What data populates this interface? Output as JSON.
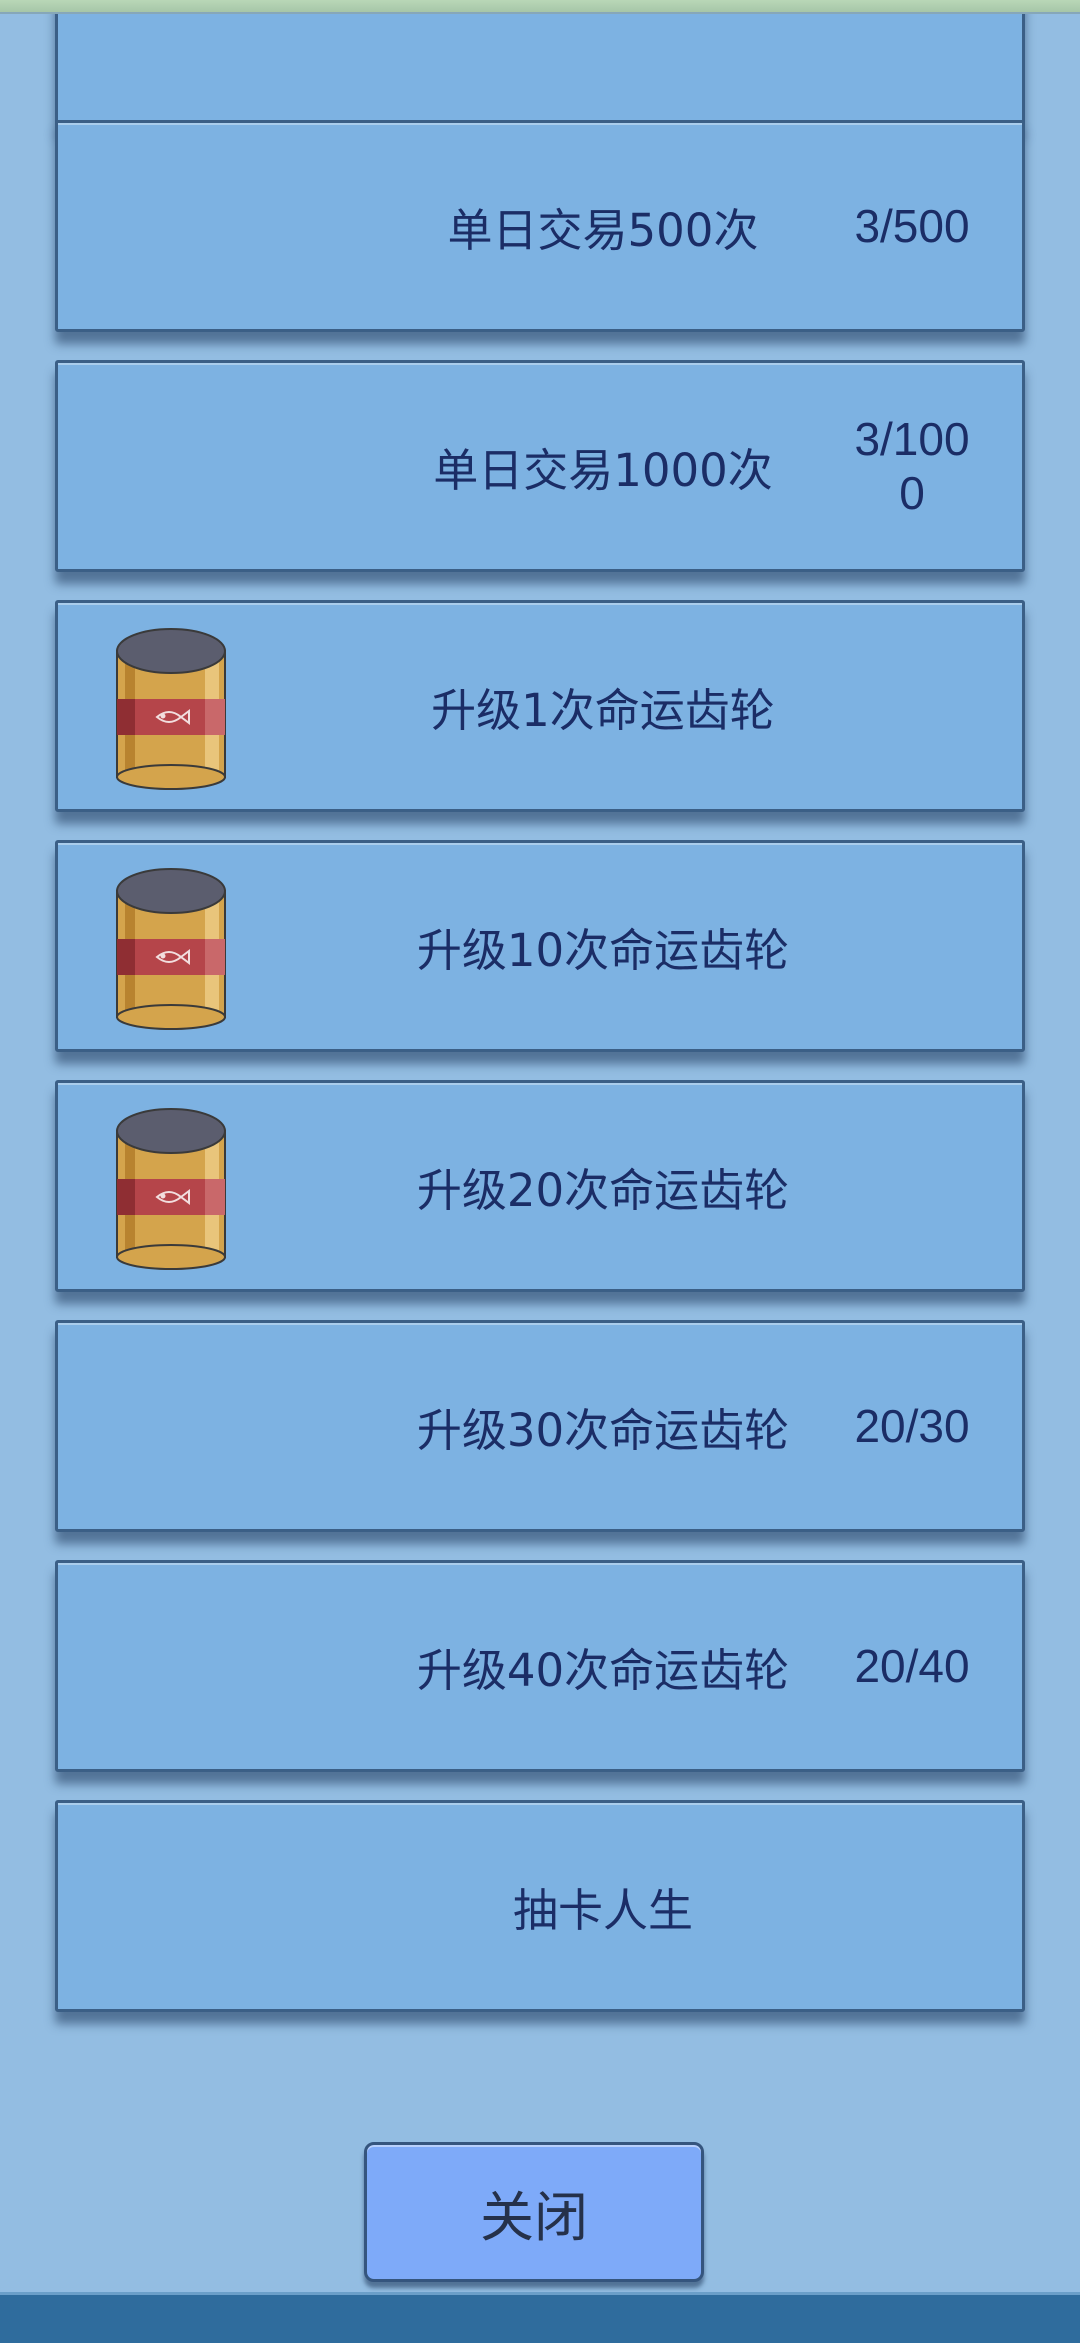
{
  "tasks": [
    {
      "title": "",
      "progress": "",
      "has_icon": false
    },
    {
      "title": "单日交易500次",
      "progress": "3/500",
      "has_icon": false
    },
    {
      "title": "单日交易1000次",
      "progress": "3/1000",
      "has_icon": false
    },
    {
      "title": "升级1次命运齿轮",
      "progress": "",
      "has_icon": true,
      "icon": "fish-can-icon"
    },
    {
      "title": "升级10次命运齿轮",
      "progress": "",
      "has_icon": true,
      "icon": "fish-can-icon"
    },
    {
      "title": "升级20次命运齿轮",
      "progress": "",
      "has_icon": true,
      "icon": "fish-can-icon"
    },
    {
      "title": "升级30次命运齿轮",
      "progress": "20/30",
      "has_icon": false
    },
    {
      "title": "升级40次命运齿轮",
      "progress": "20/40",
      "has_icon": false
    },
    {
      "title": "抽卡人生",
      "progress": "",
      "has_icon": false
    }
  ],
  "close_button": {
    "label": "关闭"
  },
  "colors": {
    "background": "#93bde2",
    "card": "#7db2e2",
    "card_border": "#3b5f86",
    "text": "#1b2d66",
    "close_button": "#7eaaf9",
    "bottom_bar": "#2f6c9d"
  }
}
